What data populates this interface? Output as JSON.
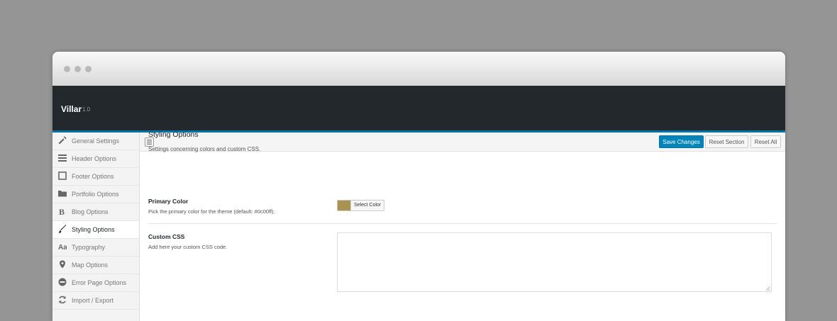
{
  "app": {
    "title": "Villar",
    "version": "1.0"
  },
  "sidebar": {
    "items": [
      {
        "label": "General Settings",
        "icon": "wrench-icon"
      },
      {
        "label": "Header Options",
        "icon": "menu-icon"
      },
      {
        "label": "Footer Options",
        "icon": "square-icon"
      },
      {
        "label": "Portfolio Options",
        "icon": "folder-icon"
      },
      {
        "label": "Blog Options",
        "icon": "bold-b-icon"
      },
      {
        "label": "Styling Options",
        "icon": "brush-icon"
      },
      {
        "label": "Typography",
        "icon": "font-icon"
      },
      {
        "label": "Map Options",
        "icon": "map-pin-icon"
      },
      {
        "label": "Error Page Options",
        "icon": "minus-circle-icon"
      },
      {
        "label": "Import / Export",
        "icon": "refresh-icon"
      }
    ],
    "active": "Styling Options"
  },
  "toolbar": {
    "save_label": "Save Changes",
    "reset_section_label": "Reset Section",
    "reset_all_label": "Reset All"
  },
  "section": {
    "title": "Styling Options",
    "description": "Settings concerning colors and custom CSS."
  },
  "fields": {
    "primary_color": {
      "title": "Primary Color",
      "description": "Pick the primary color for the theme (default: #0c00ff).",
      "button_label": "Select Color",
      "value": "#a99352"
    },
    "custom_css": {
      "title": "Custom CSS",
      "description": "Add here your custom CSS code.",
      "value": ""
    }
  },
  "colors": {
    "accent": "#0085ba",
    "header_bg": "#23282d"
  }
}
